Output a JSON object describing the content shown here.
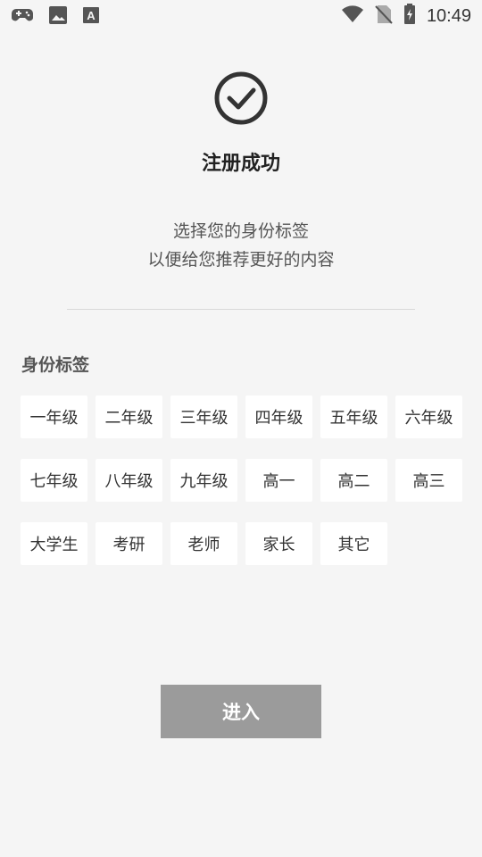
{
  "status_bar": {
    "time": "10:49",
    "left_icons": [
      "gamepad-icon",
      "image-icon",
      "font-a-icon"
    ],
    "right_icons": [
      "wifi-icon",
      "no-sim-icon",
      "battery-charging-icon"
    ],
    "font_icon_letter": "A"
  },
  "header": {
    "icon": "check-circle-icon",
    "title": "注册成功",
    "subtitle_line1": "选择您的身份标签",
    "subtitle_line2": "以便给您推荐更好的内容"
  },
  "identity": {
    "section_title": "身份标签",
    "tags": [
      "一年级",
      "二年级",
      "三年级",
      "四年级",
      "五年级",
      "六年级",
      "七年级",
      "八年级",
      "九年级",
      "高一",
      "高二",
      "高三",
      "大学生",
      "考研",
      "老师",
      "家长",
      "其它"
    ]
  },
  "actions": {
    "enter_label": "进入"
  },
  "colors": {
    "background": "#f5f5f5",
    "tag_background": "#ffffff",
    "button_background": "#9b9b9b",
    "button_text": "#ffffff"
  }
}
